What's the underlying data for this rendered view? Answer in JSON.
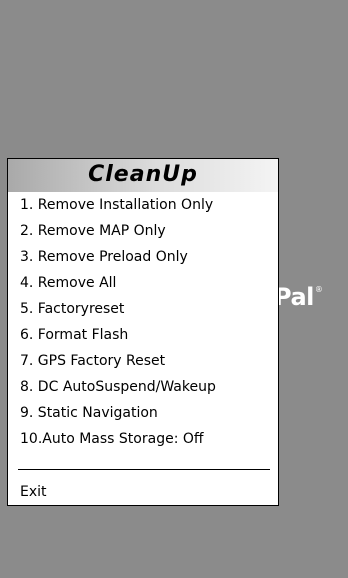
{
  "background": {
    "color": "#8b8b8b",
    "logo_text": "Pal",
    "logo_mark": "®"
  },
  "menu": {
    "title": "CleanUp",
    "items": [
      "1. Remove Installation Only",
      "2. Remove MAP Only",
      "3. Remove Preload Only",
      "4. Remove All",
      "5. Factoryreset",
      "6. Format Flash",
      "7. GPS Factory Reset",
      "8. DC AutoSuspend/Wakeup",
      "9. Static Navigation",
      "10.Auto Mass Storage: Off"
    ],
    "exit_label": "Exit"
  }
}
